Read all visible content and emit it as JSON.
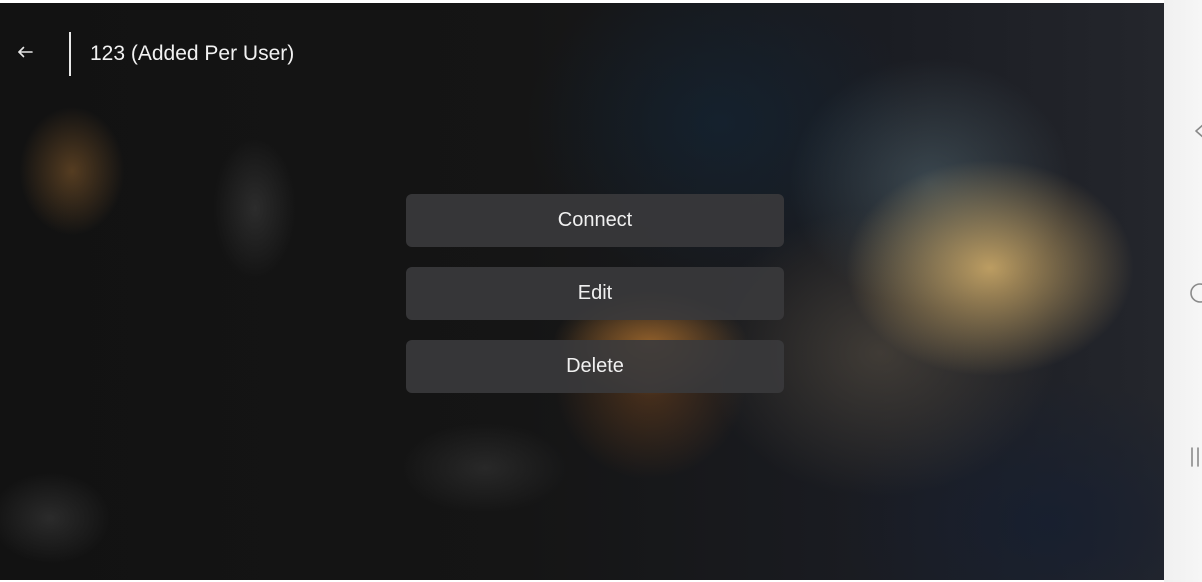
{
  "header": {
    "back_icon": "arrow-left-icon",
    "title": "123 (Added Per User)"
  },
  "menu": {
    "items": [
      {
        "label": "Connect"
      },
      {
        "label": "Edit"
      },
      {
        "label": "Delete"
      }
    ]
  },
  "side_rail": {
    "icons": [
      "back-chevron-icon",
      "home-circle-icon",
      "recent-apps-icon"
    ]
  },
  "colors": {
    "button_bg": "#3a3a3c",
    "text": "#f0f0f0",
    "rail_bg": "#f3f3f3",
    "rail_icon": "#8a8a8a"
  }
}
